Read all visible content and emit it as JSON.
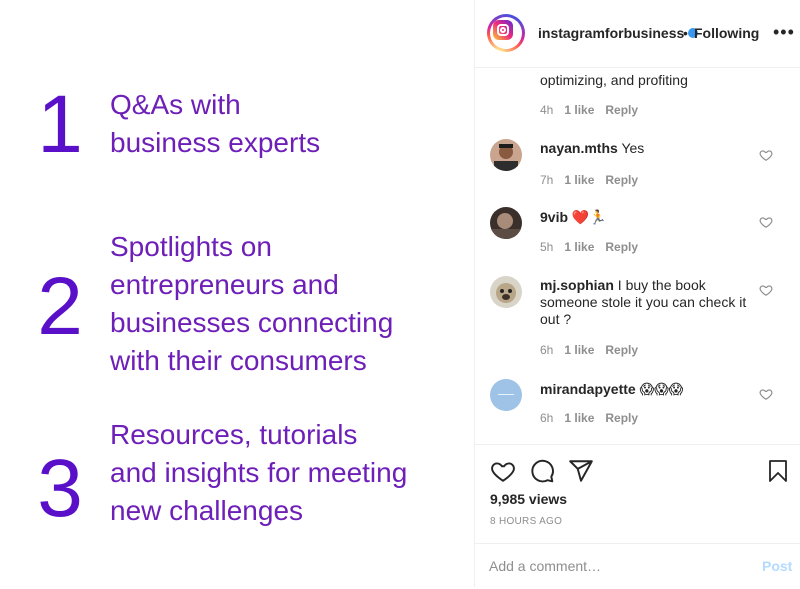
{
  "media": {
    "steps": [
      {
        "number": "1",
        "text": "Q&As with\nbusiness experts"
      },
      {
        "number": "2",
        "text": "Spotlights on\nentrepreneurs and\nbusinesses connecting\nwith their consumers"
      },
      {
        "number": "3",
        "text": "Resources, tutorials\nand insights for meeting\nnew challenges"
      }
    ]
  },
  "header": {
    "username": "instagramforbusiness",
    "separator": "•",
    "follow_label": "Following",
    "more_glyph": "•••"
  },
  "comments": {
    "previous": {
      "text": "optimizing, and profiting",
      "time": "4h",
      "likes": "1 like",
      "reply": "Reply"
    },
    "items": [
      {
        "username": "nayan.mths",
        "text": "Yes",
        "time": "7h",
        "likes": "1 like",
        "reply": "Reply"
      },
      {
        "username": "9vib",
        "text": "❤️🏃",
        "time": "5h",
        "likes": "1 like",
        "reply": "Reply"
      },
      {
        "username": "mj.sophian",
        "text": "I buy the book someone stole it you can check it out ?",
        "time": "6h",
        "likes": "1 like",
        "reply": "Reply"
      },
      {
        "username": "mirandapyette",
        "text": "😱😱😱",
        "time": "6h",
        "likes": "1 like",
        "reply": "Reply"
      }
    ]
  },
  "footer": {
    "views": "9,985 views",
    "posted_ago": "8 HOURS AGO",
    "comment_placeholder": "Add a comment…",
    "post_label": "Post"
  },
  "colors": {
    "number_purple": "#5a0fc8",
    "text_purple": "#6d1fb8",
    "link_blue": "#3897f0",
    "post_disabled": "#b3dbff"
  }
}
